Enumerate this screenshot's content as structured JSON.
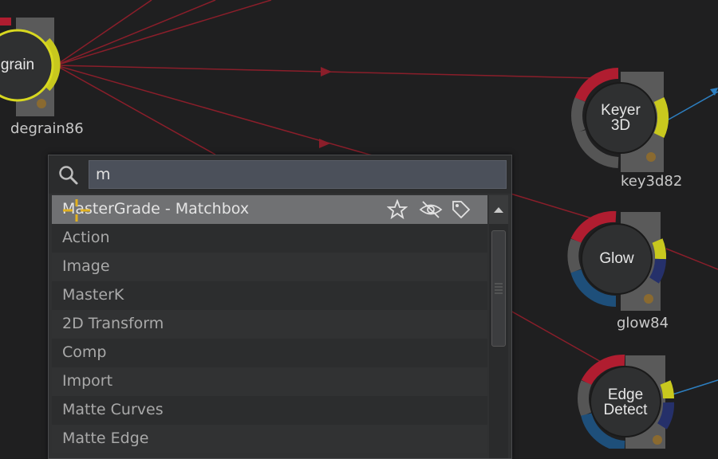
{
  "nodes": [
    {
      "id": "degrain",
      "title": "grain",
      "name": "degrain86"
    },
    {
      "id": "keyer",
      "title": "Keyer\n3D",
      "name": "key3d82"
    },
    {
      "id": "glow",
      "title": "Glow",
      "name": "glow84"
    },
    {
      "id": "edge",
      "title": "Edge\nDetect",
      "name": ""
    }
  ],
  "search": {
    "value": "m",
    "placeholder": ""
  },
  "results": [
    "MasterGrade - Matchbox",
    "Action",
    "Image",
    "MasterK",
    "2D Transform",
    "Comp",
    "Import",
    "Matte Curves",
    "Matte Edge"
  ],
  "colors": {
    "link": "#8c1f2b",
    "accent_yellow": "#c8c81e",
    "accent_red": "#b01d30",
    "accent_blue": "#1e5a8c"
  },
  "icons": [
    "search-icon",
    "star-icon",
    "hidden-icon",
    "tag-icon",
    "scroll-up-icon",
    "cursor-crosshair-icon"
  ]
}
